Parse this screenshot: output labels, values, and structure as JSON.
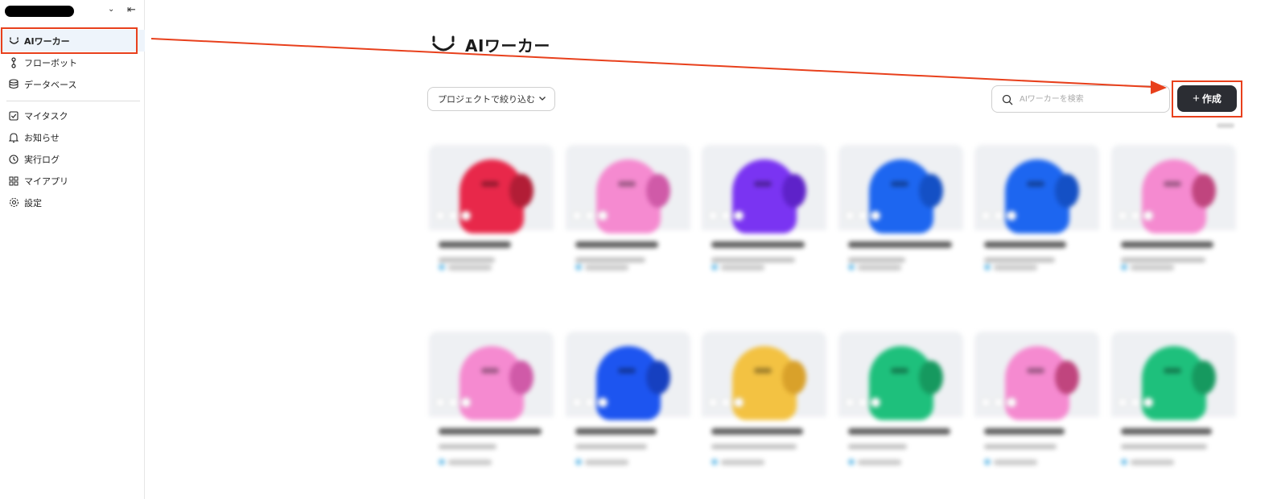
{
  "sidebar": {
    "items": [
      {
        "label": "AIワーカー",
        "icon": "smile-icon"
      },
      {
        "label": "フローボット",
        "icon": "flow-icon"
      },
      {
        "label": "データベース",
        "icon": "database-icon"
      },
      {
        "label": "マイタスク",
        "icon": "checkbox-icon"
      },
      {
        "label": "お知らせ",
        "icon": "bell-icon"
      },
      {
        "label": "実行ログ",
        "icon": "clock-icon"
      },
      {
        "label": "マイアプリ",
        "icon": "apps-icon"
      },
      {
        "label": "設定",
        "icon": "gear-icon"
      }
    ]
  },
  "main": {
    "title": "AIワーカー",
    "filter_label": "プロジェクトで絞り込む",
    "search_placeholder": "AIワーカーを検索",
    "create_label": "作成"
  },
  "cards": [
    {
      "color": "#e8284a",
      "accent": "#b21d36"
    },
    {
      "color": "#f58ad0",
      "accent": "#d05aa8"
    },
    {
      "color": "#7a34f2",
      "accent": "#5e22c9"
    },
    {
      "color": "#1d66f0",
      "accent": "#1450c5"
    },
    {
      "color": "#1d66f0",
      "accent": "#1450c5"
    },
    {
      "color": "#f58ad0",
      "accent": "#c0457e"
    },
    {
      "color": "#f58ad0",
      "accent": "#d05aa8"
    },
    {
      "color": "#1d55f0",
      "accent": "#1640c0"
    },
    {
      "color": "#f3c242",
      "accent": "#d9a12a"
    },
    {
      "color": "#1ec07c",
      "accent": "#16995f"
    },
    {
      "color": "#f58ad0",
      "accent": "#c0457e"
    },
    {
      "color": "#1ec07c",
      "accent": "#16995f"
    }
  ],
  "colors": {
    "highlight": "#e8401c",
    "create_button": "#2b2d33",
    "active_nav": "#eef4fb"
  }
}
